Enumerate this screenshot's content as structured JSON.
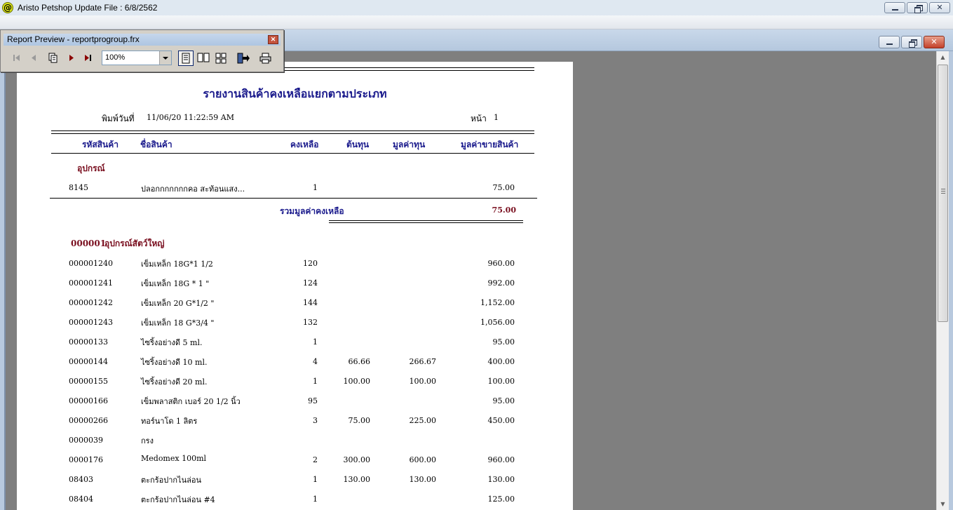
{
  "app": {
    "title": "Aristo Petshop  Update File : 6/8/2562",
    "icon_char": "@"
  },
  "preview_toolbar": {
    "title": "Report Preview - reportprogroup.frx",
    "zoom_value": "100%",
    "buttons": [
      "first-page-icon",
      "prev-page-icon",
      "goto-page-icon",
      "next-page-icon",
      "last-page-icon",
      "one-page-icon",
      "two-pages-icon",
      "multi-pages-icon",
      "close-preview-icon",
      "print-icon"
    ]
  },
  "report": {
    "title": "รายงานสินค้าคงเหลือแยกตามประเภท",
    "print_label": "พิมพ์วันที่",
    "print_value": "11/06/20 11:22:59 AM",
    "page_label": "หน้า",
    "page_value": "1",
    "headers": {
      "code": "รหัสสินค้า",
      "name": "ชื่อสินค้า",
      "qty": "คงเหลือ",
      "cost": "ต้นทุน",
      "value": "มูลค่าทุน",
      "sale": "มูลค่าขายสินค้า"
    },
    "group1": {
      "name": "อุปกรณ์",
      "rows": [
        {
          "code": "8145",
          "name": "ปลอกกกกกกกคอ สะท้อนแสง...",
          "qty": "1",
          "cost": "",
          "value": "",
          "sale": "75.00"
        }
      ],
      "subtotal_label": "รวมมูลค่าคงเหลือ",
      "subtotal_value": "75.00"
    },
    "group2": {
      "code": "000001",
      "name": "อุปกรณ์สัตว์ใหญ่",
      "rows": [
        {
          "code": "000001240",
          "name": "เข็มเหล็ก 18G*1 1/2",
          "qty": "120",
          "cost": "",
          "value": "",
          "sale": "960.00"
        },
        {
          "code": "000001241",
          "name": "เข็มเหล็ก 18G * 1 \"",
          "qty": "124",
          "cost": "",
          "value": "",
          "sale": "992.00"
        },
        {
          "code": "000001242",
          "name": "เข็มเหล็ก 20 G*1/2 \"",
          "qty": "144",
          "cost": "",
          "value": "",
          "sale": "1,152.00"
        },
        {
          "code": "000001243",
          "name": "เข็มเหล็ก 18 G*3/4 \"",
          "qty": "132",
          "cost": "",
          "value": "",
          "sale": "1,056.00"
        },
        {
          "code": "00000133",
          "name": "ไซริ้งอย่างดี 5 ml.",
          "qty": "1",
          "cost": "",
          "value": "",
          "sale": "95.00"
        },
        {
          "code": "00000144",
          "name": "ไซริ้งอย่างดี 10 ml.",
          "qty": "4",
          "cost": "66.66",
          "value": "266.67",
          "sale": "400.00"
        },
        {
          "code": "00000155",
          "name": "ไซริ้งอย่างดี 20 ml.",
          "qty": "1",
          "cost": "100.00",
          "value": "100.00",
          "sale": "100.00"
        },
        {
          "code": "00000166",
          "name": "เข็มพลาสติก เบอร์ 20 1/2 นิ้ว",
          "qty": "95",
          "cost": "",
          "value": "",
          "sale": "95.00"
        },
        {
          "code": "00000266",
          "name": "ทอร์นาโด 1 ลิตร",
          "qty": "3",
          "cost": "75.00",
          "value": "225.00",
          "sale": "450.00"
        },
        {
          "code": "0000039",
          "name": "กรง",
          "qty": "",
          "cost": "",
          "value": "",
          "sale": ""
        },
        {
          "code": "0000176",
          "name": "Medomex 100ml",
          "qty": "2",
          "cost": "300.00",
          "value": "600.00",
          "sale": "960.00"
        },
        {
          "code": "08403",
          "name": "ตะกร้อปากไนล่อน",
          "qty": "1",
          "cost": "130.00",
          "value": "130.00",
          "sale": "130.00"
        },
        {
          "code": "08404",
          "name": "ตะกร้อปากไนล่อน #4",
          "qty": "1",
          "cost": "",
          "value": "",
          "sale": "125.00"
        }
      ]
    }
  }
}
